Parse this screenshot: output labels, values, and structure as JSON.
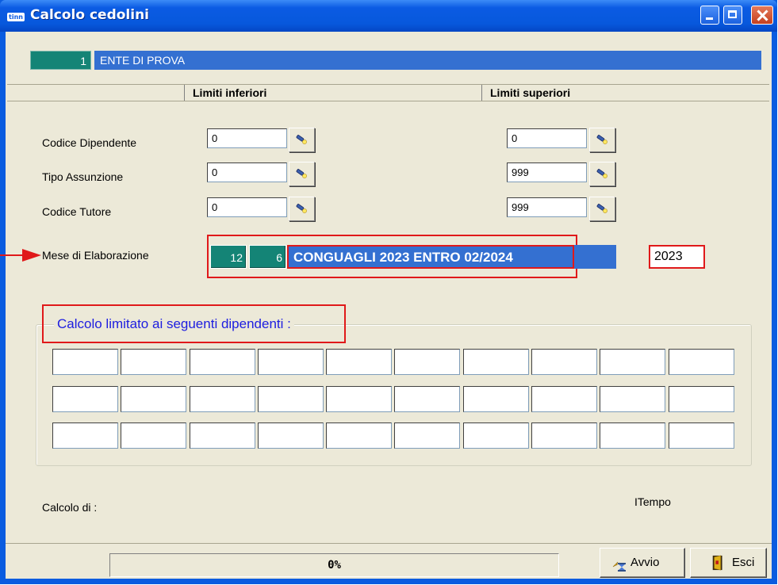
{
  "window": {
    "title": "Calcolo cedolini",
    "app_icon_text": "tinn"
  },
  "company": {
    "code": "1",
    "name": "ENTE DI PROVA"
  },
  "headers": {
    "lower": "Limiti inferiori",
    "upper": "Limiti superiori"
  },
  "fields": [
    {
      "label": "Codice Dipendente",
      "lower": "0",
      "upper": "0"
    },
    {
      "label": "Tipo Assunzione",
      "lower": "0",
      "upper": "999"
    },
    {
      "label": "Codice Tutore",
      "lower": "0",
      "upper": "999"
    }
  ],
  "mese": {
    "label": "Mese di Elaborazione",
    "month": "12",
    "type": "6",
    "description": "CONGUAGLI 2023 ENTRO 02/2024",
    "year": "2023"
  },
  "limited": {
    "title": "Calcolo limitato ai seguenti dipendenti :",
    "rows": [
      [
        "",
        "",
        "",
        "",
        "",
        "",
        "",
        "",
        "",
        ""
      ],
      [
        "",
        "",
        "",
        "",
        "",
        "",
        "",
        "",
        "",
        ""
      ],
      [
        "",
        "",
        "",
        "",
        "",
        "",
        "",
        "",
        "",
        ""
      ]
    ]
  },
  "status": {
    "calc_label": "Calcolo di :",
    "time_label": "ITempo",
    "progress": "0%"
  },
  "buttons": {
    "start": "Avvio",
    "exit": "Esci"
  },
  "icons": {
    "lookup": "flashlight-icon",
    "start": "hourglass-lightning-icon",
    "exit": "exit-door-icon"
  },
  "colors": {
    "title_bar": "#0b5be3",
    "teal_field": "#148476",
    "blue_field": "#3470d1",
    "highlight": "#e0191a",
    "group_title": "#1d1de0"
  }
}
